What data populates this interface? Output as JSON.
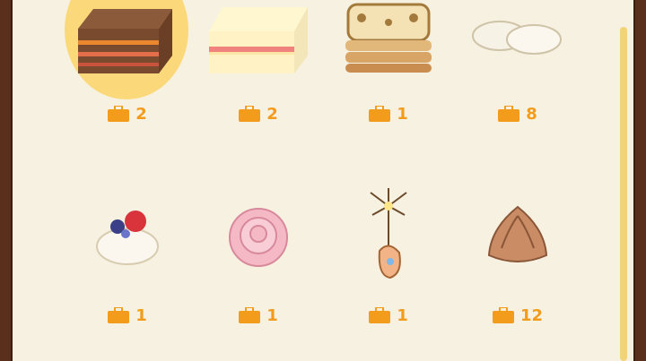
{
  "inventory": {
    "items": [
      {
        "name": "chocolate-layer-cake",
        "count": "2"
      },
      {
        "name": "strawberry-shortcake-slice",
        "count": "2"
      },
      {
        "name": "decorated-biscuit-cake",
        "count": "1"
      },
      {
        "name": "white-meringues",
        "count": "8"
      },
      {
        "name": "berry-cream-dessert",
        "count": "1"
      },
      {
        "name": "pink-rose-cake",
        "count": "1"
      },
      {
        "name": "sparkler-cookie",
        "count": "1"
      },
      {
        "name": "chocolate-meringue",
        "count": "12"
      }
    ]
  },
  "colors": {
    "count_text": "#f39b1a",
    "background": "#f7f1e1",
    "highlight": "#fbd97a"
  }
}
